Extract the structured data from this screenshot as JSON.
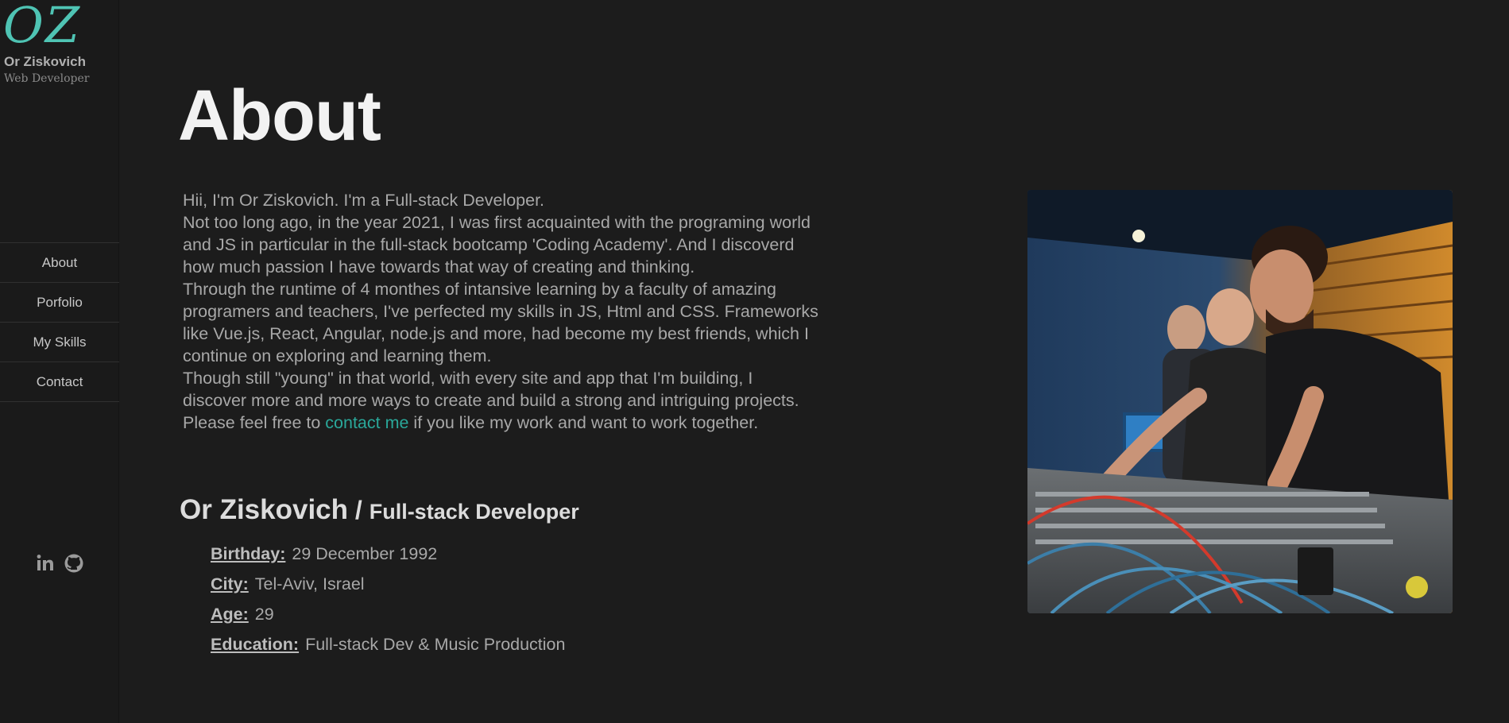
{
  "sidebar": {
    "logo_text": "OZ",
    "name": "Or Ziskovich",
    "role": "Web Developer",
    "nav": [
      "About",
      "Porfolio",
      "My Skills",
      "Contact"
    ],
    "socials": [
      "linkedin-icon",
      "github-icon"
    ]
  },
  "main": {
    "title": "About",
    "bio": {
      "p1": "Hii, I'm Or Ziskovich. I'm a Full-stack Developer.",
      "p2": "Not too long ago, in the year 2021, I was first acquainted with the programing world and JS in particular in the full-stack bootcamp 'Coding Academy'. And I discoverd how much passion I have towards that way of creating and thinking.",
      "p3": "Through the runtime of 4 monthes of intansive learning by a faculty of amazing programers and teachers, I've perfected my skills in JS, Html and CSS. Frameworks like Vue.js, React, Angular, node.js and more, had become my best friends, which I continue on exploring and learning them.",
      "p4": "Though still \"young\" in that world, with every site and app that I'm building, I discover more and more ways to create and build a strong and intriguing projects.",
      "p5_before": "Please feel free to ",
      "p5_link": "contact me",
      "p5_after": " if you like my work and want to work together."
    },
    "profile": {
      "name": "Or Ziskovich",
      "separator": " / ",
      "role": "Full-stack Developer",
      "details": [
        {
          "label": "Birthday:",
          "value": "29 December 1992"
        },
        {
          "label": "City:",
          "value": "Tel-Aviv, Israel"
        },
        {
          "label": "Age:",
          "value": "29"
        },
        {
          "label": "Education:",
          "value": "Full-stack Dev & Music Production"
        }
      ]
    },
    "photo": {
      "description": ""
    }
  },
  "colors": {
    "background": "#1c1c1c",
    "accent": "#2aa89a",
    "logo": "#4fc4b4",
    "text": "#a8a8a8",
    "heading": "#f2f2f2"
  }
}
